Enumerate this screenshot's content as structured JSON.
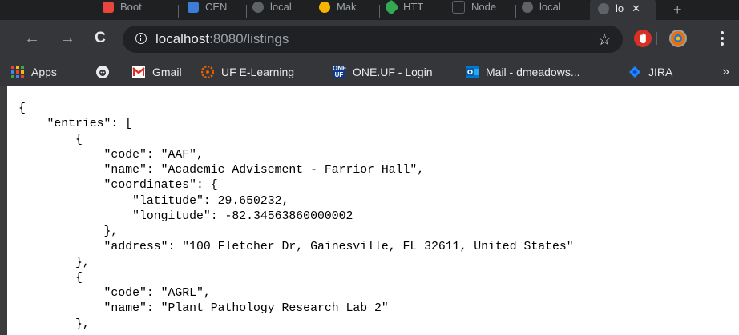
{
  "tabs": [
    {
      "label": "Boot",
      "favicon": "boot-favicon",
      "color": "#e8453c"
    },
    {
      "label": "CEN",
      "favicon": "cen-favicon",
      "color": "#3b7dd8"
    },
    {
      "label": "local",
      "favicon": "globe-favicon",
      "color": "#9aa0a6"
    },
    {
      "label": "Mak",
      "favicon": "mak-favicon",
      "color": "#f4b400"
    },
    {
      "label": "HTT",
      "favicon": "htt-favicon",
      "color": "#34a853"
    },
    {
      "label": "Node",
      "favicon": "node-favicon",
      "color": "#5f6368"
    },
    {
      "label": "local",
      "favicon": "globe-favicon",
      "color": "#9aa0a6"
    }
  ],
  "active_tab": {
    "label": "lo",
    "favicon": "globe-favicon"
  },
  "toolbar": {
    "url_host": "localhost",
    "url_rest": ":8080/listings",
    "back_icon": "←",
    "forward_icon": "→",
    "reload_icon": "C",
    "star_icon": "☆",
    "extension_1_color": "#d93025",
    "extension_2_color": "#e8710a"
  },
  "bookmarks": [
    {
      "label": "Apps",
      "icon": "apps-grid-icon"
    },
    {
      "label": "",
      "icon": "github-icon"
    },
    {
      "label": "Gmail",
      "icon": "gmail-icon"
    },
    {
      "label": "UF E-Learning",
      "icon": "canvas-icon"
    },
    {
      "label": "ONE.UF - Login",
      "icon": "oneuf-icon"
    },
    {
      "label": "Mail - dmeadows...",
      "icon": "outlook-icon"
    },
    {
      "label": "JIRA",
      "icon": "jira-icon"
    }
  ],
  "bookmarks_more": "»",
  "json_text": "{\n    \"entries\": [\n        {\n            \"code\": \"AAF\",\n            \"name\": \"Academic Advisement - Farrior Hall\",\n            \"coordinates\": {\n                \"latitude\": 29.650232,\n                \"longitude\": -82.34563860000002\n            },\n            \"address\": \"100 Fletcher Dr, Gainesville, FL 32611, United States\"\n        },\n        {\n            \"code\": \"AGRL\",\n            \"name\": \"Plant Pathology Research Lab 2\"\n        },"
}
